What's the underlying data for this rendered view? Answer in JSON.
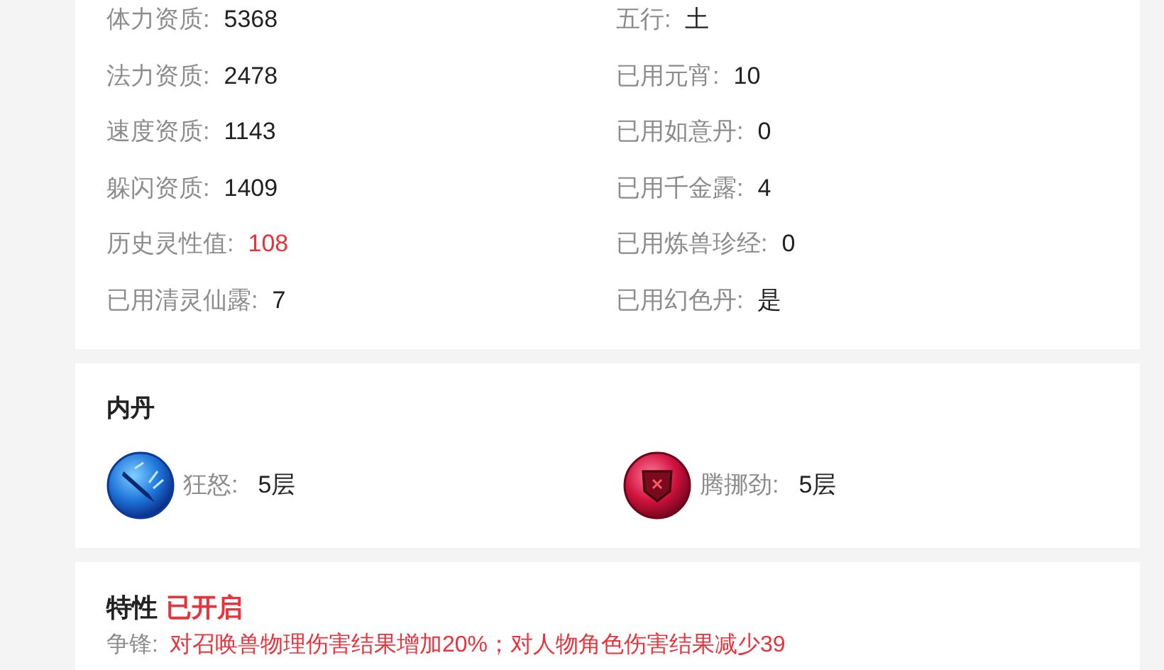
{
  "attributes": [
    {
      "label": "体力资质:",
      "value": "5368",
      "highlight": false
    },
    {
      "label": "五行:",
      "value": "土",
      "highlight": false
    },
    {
      "label": "法力资质:",
      "value": "2478",
      "highlight": false
    },
    {
      "label": "已用元宵:",
      "value": "10",
      "highlight": false
    },
    {
      "label": "速度资质:",
      "value": "1143",
      "highlight": false
    },
    {
      "label": "已用如意丹:",
      "value": "0",
      "highlight": false
    },
    {
      "label": "躲闪资质:",
      "value": "1409",
      "highlight": false
    },
    {
      "label": "已用千金露:",
      "value": "4",
      "highlight": false
    },
    {
      "label": "历史灵性值:",
      "value": "108",
      "highlight": true
    },
    {
      "label": "已用炼兽珍经:",
      "value": "0",
      "highlight": false
    },
    {
      "label": "已用清灵仙露:",
      "value": "7",
      "highlight": false
    },
    {
      "label": "已用幻色丹:",
      "value": "是",
      "highlight": false
    }
  ],
  "neidan": {
    "title": "内丹",
    "items": [
      {
        "kind": "blade",
        "name": "狂怒:",
        "level_text": "5层"
      },
      {
        "kind": "shield",
        "name": "腾挪劲:",
        "level_text": "5层"
      }
    ]
  },
  "traits": {
    "title": "特性",
    "status": "已开启",
    "enabled": true,
    "line": {
      "label": "争锋:",
      "text": "对召唤兽物理伤害结果增加20%；对人物角色伤害结果减少39"
    }
  }
}
